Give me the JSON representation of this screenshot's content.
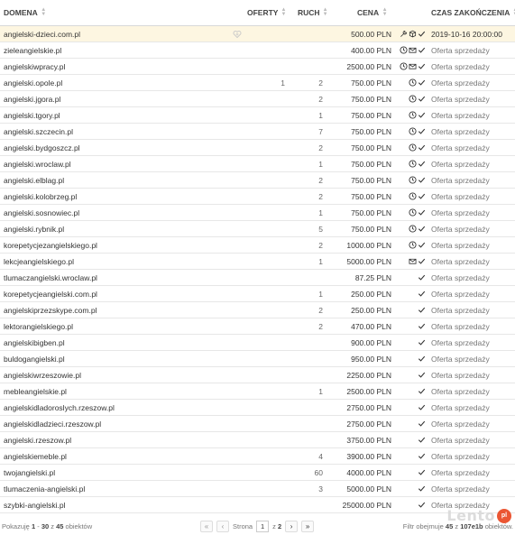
{
  "columns": {
    "domain": "DOMENA",
    "offers": "OFERTY",
    "traffic": "RUCH",
    "price": "CENA",
    "end_time": "CZAS ZAKOŃCZENIA"
  },
  "rows": [
    {
      "domain": "angielski-dzieci.com.pl",
      "offers": "",
      "traffic": "",
      "price": "500.00 PLN",
      "icons": [
        "tools-icon",
        "box-icon",
        "check-icon"
      ],
      "end": "2019-10-16 20:00:00",
      "highlight": true,
      "fav": true
    },
    {
      "domain": "zieleangielskie.pl",
      "offers": "",
      "traffic": "",
      "price": "400.00 PLN",
      "icons": [
        "clock-icon",
        "mail-icon",
        "check-icon"
      ],
      "end": "Oferta sprzedaży"
    },
    {
      "domain": "angielskiwpracy.pl",
      "offers": "",
      "traffic": "",
      "price": "2500.00 PLN",
      "icons": [
        "clock-icon",
        "mail-icon",
        "check-icon"
      ],
      "end": "Oferta sprzedaży"
    },
    {
      "domain": "angielski.opole.pl",
      "offers": "1",
      "traffic": "2",
      "price": "750.00 PLN",
      "icons": [
        "clock-icon",
        "check-icon"
      ],
      "end": "Oferta sprzedaży"
    },
    {
      "domain": "angielski.jgora.pl",
      "offers": "",
      "traffic": "2",
      "price": "750.00 PLN",
      "icons": [
        "clock-icon",
        "check-icon"
      ],
      "end": "Oferta sprzedaży"
    },
    {
      "domain": "angielski.tgory.pl",
      "offers": "",
      "traffic": "1",
      "price": "750.00 PLN",
      "icons": [
        "clock-icon",
        "check-icon"
      ],
      "end": "Oferta sprzedaży"
    },
    {
      "domain": "angielski.szczecin.pl",
      "offers": "",
      "traffic": "7",
      "price": "750.00 PLN",
      "icons": [
        "clock-icon",
        "check-icon"
      ],
      "end": "Oferta sprzedaży"
    },
    {
      "domain": "angielski.bydgoszcz.pl",
      "offers": "",
      "traffic": "2",
      "price": "750.00 PLN",
      "icons": [
        "clock-icon",
        "check-icon"
      ],
      "end": "Oferta sprzedaży"
    },
    {
      "domain": "angielski.wroclaw.pl",
      "offers": "",
      "traffic": "1",
      "price": "750.00 PLN",
      "icons": [
        "clock-icon",
        "check-icon"
      ],
      "end": "Oferta sprzedaży"
    },
    {
      "domain": "angielski.elblag.pl",
      "offers": "",
      "traffic": "2",
      "price": "750.00 PLN",
      "icons": [
        "clock-icon",
        "check-icon"
      ],
      "end": "Oferta sprzedaży"
    },
    {
      "domain": "angielski.kolobrzeg.pl",
      "offers": "",
      "traffic": "2",
      "price": "750.00 PLN",
      "icons": [
        "clock-icon",
        "check-icon"
      ],
      "end": "Oferta sprzedaży"
    },
    {
      "domain": "angielski.sosnowiec.pl",
      "offers": "",
      "traffic": "1",
      "price": "750.00 PLN",
      "icons": [
        "clock-icon",
        "check-icon"
      ],
      "end": "Oferta sprzedaży"
    },
    {
      "domain": "angielski.rybnik.pl",
      "offers": "",
      "traffic": "5",
      "price": "750.00 PLN",
      "icons": [
        "clock-icon",
        "check-icon"
      ],
      "end": "Oferta sprzedaży"
    },
    {
      "domain": "korepetycjezangielskiego.pl",
      "offers": "",
      "traffic": "2",
      "price": "1000.00 PLN",
      "icons": [
        "clock-icon",
        "check-icon"
      ],
      "end": "Oferta sprzedaży"
    },
    {
      "domain": "lekcjeangielskiego.pl",
      "offers": "",
      "traffic": "1",
      "price": "5000.00 PLN",
      "icons": [
        "mail-icon",
        "check-icon"
      ],
      "end": "Oferta sprzedaży"
    },
    {
      "domain": "tlumaczangielski.wroclaw.pl",
      "offers": "",
      "traffic": "",
      "price": "87.25 PLN",
      "icons": [
        "check-icon"
      ],
      "end": "Oferta sprzedaży"
    },
    {
      "domain": "korepetycjeangielski.com.pl",
      "offers": "",
      "traffic": "1",
      "price": "250.00 PLN",
      "icons": [
        "check-icon"
      ],
      "end": "Oferta sprzedaży"
    },
    {
      "domain": "angielskiprzezskype.com.pl",
      "offers": "",
      "traffic": "2",
      "price": "250.00 PLN",
      "icons": [
        "check-icon"
      ],
      "end": "Oferta sprzedaży"
    },
    {
      "domain": "lektorangielskiego.pl",
      "offers": "",
      "traffic": "2",
      "price": "470.00 PLN",
      "icons": [
        "check-icon"
      ],
      "end": "Oferta sprzedaży"
    },
    {
      "domain": "angielskibigben.pl",
      "offers": "",
      "traffic": "",
      "price": "900.00 PLN",
      "icons": [
        "check-icon"
      ],
      "end": "Oferta sprzedaży"
    },
    {
      "domain": "buldogangielski.pl",
      "offers": "",
      "traffic": "",
      "price": "950.00 PLN",
      "icons": [
        "check-icon"
      ],
      "end": "Oferta sprzedaży"
    },
    {
      "domain": "angielskiwrzeszowie.pl",
      "offers": "",
      "traffic": "",
      "price": "2250.00 PLN",
      "icons": [
        "check-icon"
      ],
      "end": "Oferta sprzedaży"
    },
    {
      "domain": "mebleangielskie.pl",
      "offers": "",
      "traffic": "1",
      "price": "2500.00 PLN",
      "icons": [
        "check-icon"
      ],
      "end": "Oferta sprzedaży"
    },
    {
      "domain": "angielskidladoroslych.rzeszow.pl",
      "offers": "",
      "traffic": "",
      "price": "2750.00 PLN",
      "icons": [
        "check-icon"
      ],
      "end": "Oferta sprzedaży"
    },
    {
      "domain": "angielskidladzieci.rzeszow.pl",
      "offers": "",
      "traffic": "",
      "price": "2750.00 PLN",
      "icons": [
        "check-icon"
      ],
      "end": "Oferta sprzedaży"
    },
    {
      "domain": "angielski.rzeszow.pl",
      "offers": "",
      "traffic": "",
      "price": "3750.00 PLN",
      "icons": [
        "check-icon"
      ],
      "end": "Oferta sprzedaży"
    },
    {
      "domain": "angielskiemeble.pl",
      "offers": "",
      "traffic": "4",
      "price": "3900.00 PLN",
      "icons": [
        "check-icon"
      ],
      "end": "Oferta sprzedaży"
    },
    {
      "domain": "twojangielski.pl",
      "offers": "",
      "traffic": "60",
      "price": "4000.00 PLN",
      "icons": [
        "check-icon"
      ],
      "end": "Oferta sprzedaży"
    },
    {
      "domain": "tlumaczenia-angielski.pl",
      "offers": "",
      "traffic": "3",
      "price": "5000.00 PLN",
      "icons": [
        "check-icon"
      ],
      "end": "Oferta sprzedaży"
    },
    {
      "domain": "szybki-angielski.pl",
      "offers": "",
      "traffic": "",
      "price": "25000.00 PLN",
      "icons": [
        "check-icon"
      ],
      "end": "Oferta sprzedaży"
    }
  ],
  "footer": {
    "showing_prefix": "Pokazuję",
    "showing_from": "1",
    "showing_dash": "-",
    "showing_to": "30",
    "showing_of": "z",
    "showing_total": "45",
    "showing_suffix": "obiektów",
    "page_label": "Strona",
    "page_value": "1",
    "page_of": "z",
    "page_total": "2",
    "filter_prefix": "Filtr obejmuje",
    "filter_count": "45",
    "filter_of": "z",
    "filter_total": "107e1b",
    "filter_suffix": "obiektów."
  },
  "watermark": {
    "text": "Lento",
    "badge": "pl",
    "badge_color": "#e9441d"
  },
  "colors": {
    "highlight_row": "#fdf6e1",
    "border": "#e7e7e7"
  }
}
